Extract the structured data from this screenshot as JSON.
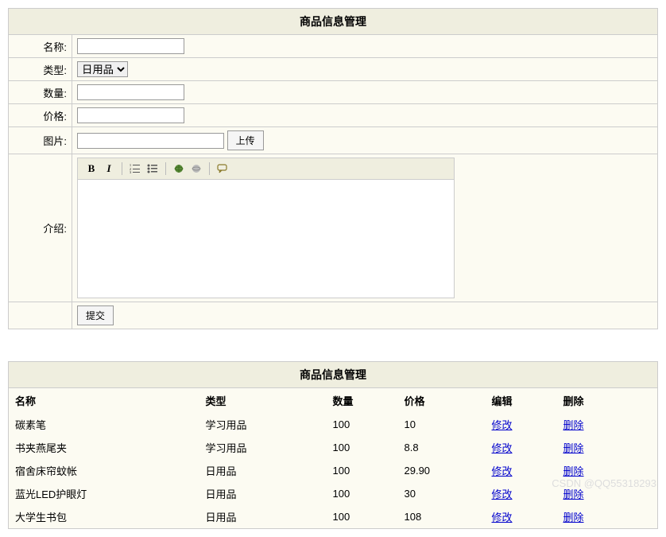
{
  "form": {
    "title": "商品信息管理",
    "labels": {
      "name": "名称:",
      "type": "类型:",
      "qty": "数量:",
      "price": "价格:",
      "image": "图片:",
      "intro": "介绍:"
    },
    "type_selected": "日用品",
    "upload_btn": "上传",
    "submit_btn": "提交"
  },
  "list": {
    "title": "商品信息管理",
    "headers": {
      "name": "名称",
      "type": "类型",
      "qty": "数量",
      "price": "价格",
      "edit": "编辑",
      "delete": "删除"
    },
    "edit_label": "修改",
    "delete_label": "删除",
    "rows": [
      {
        "name": "碳素笔",
        "type": "学习用品",
        "qty": "100",
        "price": "10"
      },
      {
        "name": "书夹燕尾夹",
        "type": "学习用品",
        "qty": "100",
        "price": "8.8"
      },
      {
        "name": "宿舍床帘蚊帐",
        "type": "日用品",
        "qty": "100",
        "price": "29.90"
      },
      {
        "name": "蓝光LED护眼灯",
        "type": "日用品",
        "qty": "100",
        "price": "30"
      },
      {
        "name": "大学生书包",
        "type": "日用品",
        "qty": "100",
        "price": "108"
      }
    ]
  },
  "watermark": "CSDN @QQ55318293"
}
